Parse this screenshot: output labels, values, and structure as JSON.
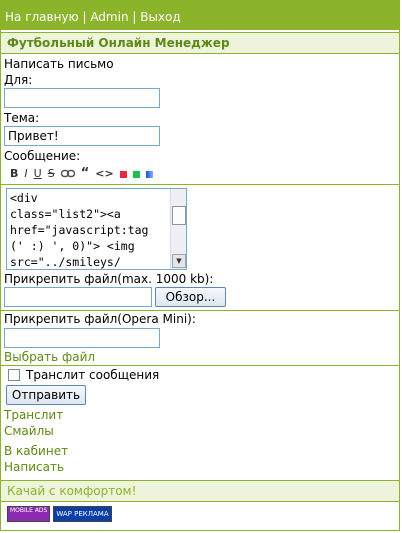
{
  "nav": {
    "home": "На главную",
    "sep1": " | ",
    "admin": "Admin",
    "sep2": " | ",
    "logout": "Выход"
  },
  "site_title": "Футбольный Онлайн Менеджер",
  "form": {
    "heading": "Написать письмо",
    "to_label": "Для:",
    "to_value": "",
    "subject_label": "Тема:",
    "subject_value": "Привет!",
    "message_label": "Сообщение:",
    "toolbar": [
      "B",
      "I",
      "U",
      "S",
      "link",
      "quote",
      "code",
      "red",
      "green",
      "blue"
    ],
    "toolbar_colors": {
      "red": "#e8283c",
      "green": "#20c050",
      "blue": "#2050d0"
    },
    "message_text": "<div\nclass=\"list2\"><a\nhref=\"javascript:tag\n(' :) ', 0)\"> <img\nsrc=\"../smileys/",
    "attach_label": "Прикрепить файл(max. 1000 kb):",
    "browse_button": "Обзор...",
    "attach_opera_label": "Прикрепить файл(Opera Mini):",
    "choose_file": "Выбрать файл",
    "translit_checkbox": "Транслит сообщения",
    "send_button": "Отправить"
  },
  "links": {
    "translit": "Транслит",
    "smileys": "Смайлы",
    "cabinet": "В кабинет",
    "write": "Написать"
  },
  "footer": {
    "slogan": "Качай с комфортом!",
    "ad1": "MOBILE ADS",
    "ad2": "WAP РЕКЛАМА"
  }
}
